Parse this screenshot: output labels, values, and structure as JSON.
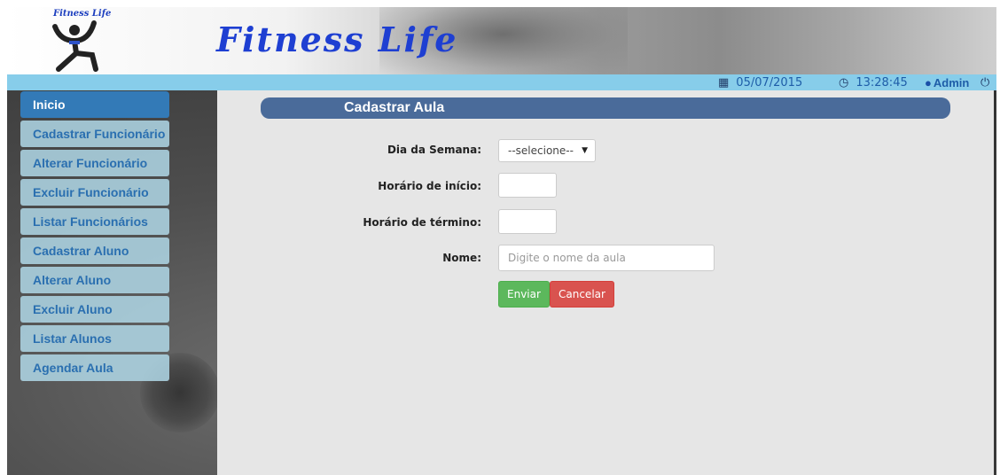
{
  "brand": {
    "small_logo_text": "Fitness Life",
    "title": "Fitness Life"
  },
  "topbar": {
    "date": "05/07/2015",
    "time": "13:28:45",
    "user": "Admin",
    "icons": {
      "date": "calendar-icon",
      "time": "clock-icon",
      "user": "user-icon",
      "logout": "power-icon"
    }
  },
  "sidebar": {
    "items": [
      {
        "label": "Inicio",
        "active": true
      },
      {
        "label": "Cadastrar Funcionário"
      },
      {
        "label": "Alterar Funcionário"
      },
      {
        "label": "Excluir Funcionário"
      },
      {
        "label": "Listar Funcionários"
      },
      {
        "label": "Cadastrar Aluno"
      },
      {
        "label": "Alterar Aluno"
      },
      {
        "label": "Excluir Aluno"
      },
      {
        "label": "Listar Alunos"
      },
      {
        "label": "Agendar Aula"
      }
    ]
  },
  "form": {
    "title": "Cadastrar Aula",
    "day_label": "Dia da Semana:",
    "day_selected": "--selecione--",
    "start_label": "Horário de início:",
    "start_value": "",
    "end_label": "Horário de término:",
    "end_value": "",
    "name_label": "Nome:",
    "name_placeholder": "Digite o nome da aula",
    "submit_label": "Enviar",
    "cancel_label": "Cancelar"
  },
  "colors": {
    "topbar": "#87cdea",
    "nav_active": "#337ab7",
    "section_header": "#4a6b9a",
    "button_ok": "#5cb85c",
    "button_cancel": "#d9534f",
    "brand": "#1e3fd2"
  }
}
